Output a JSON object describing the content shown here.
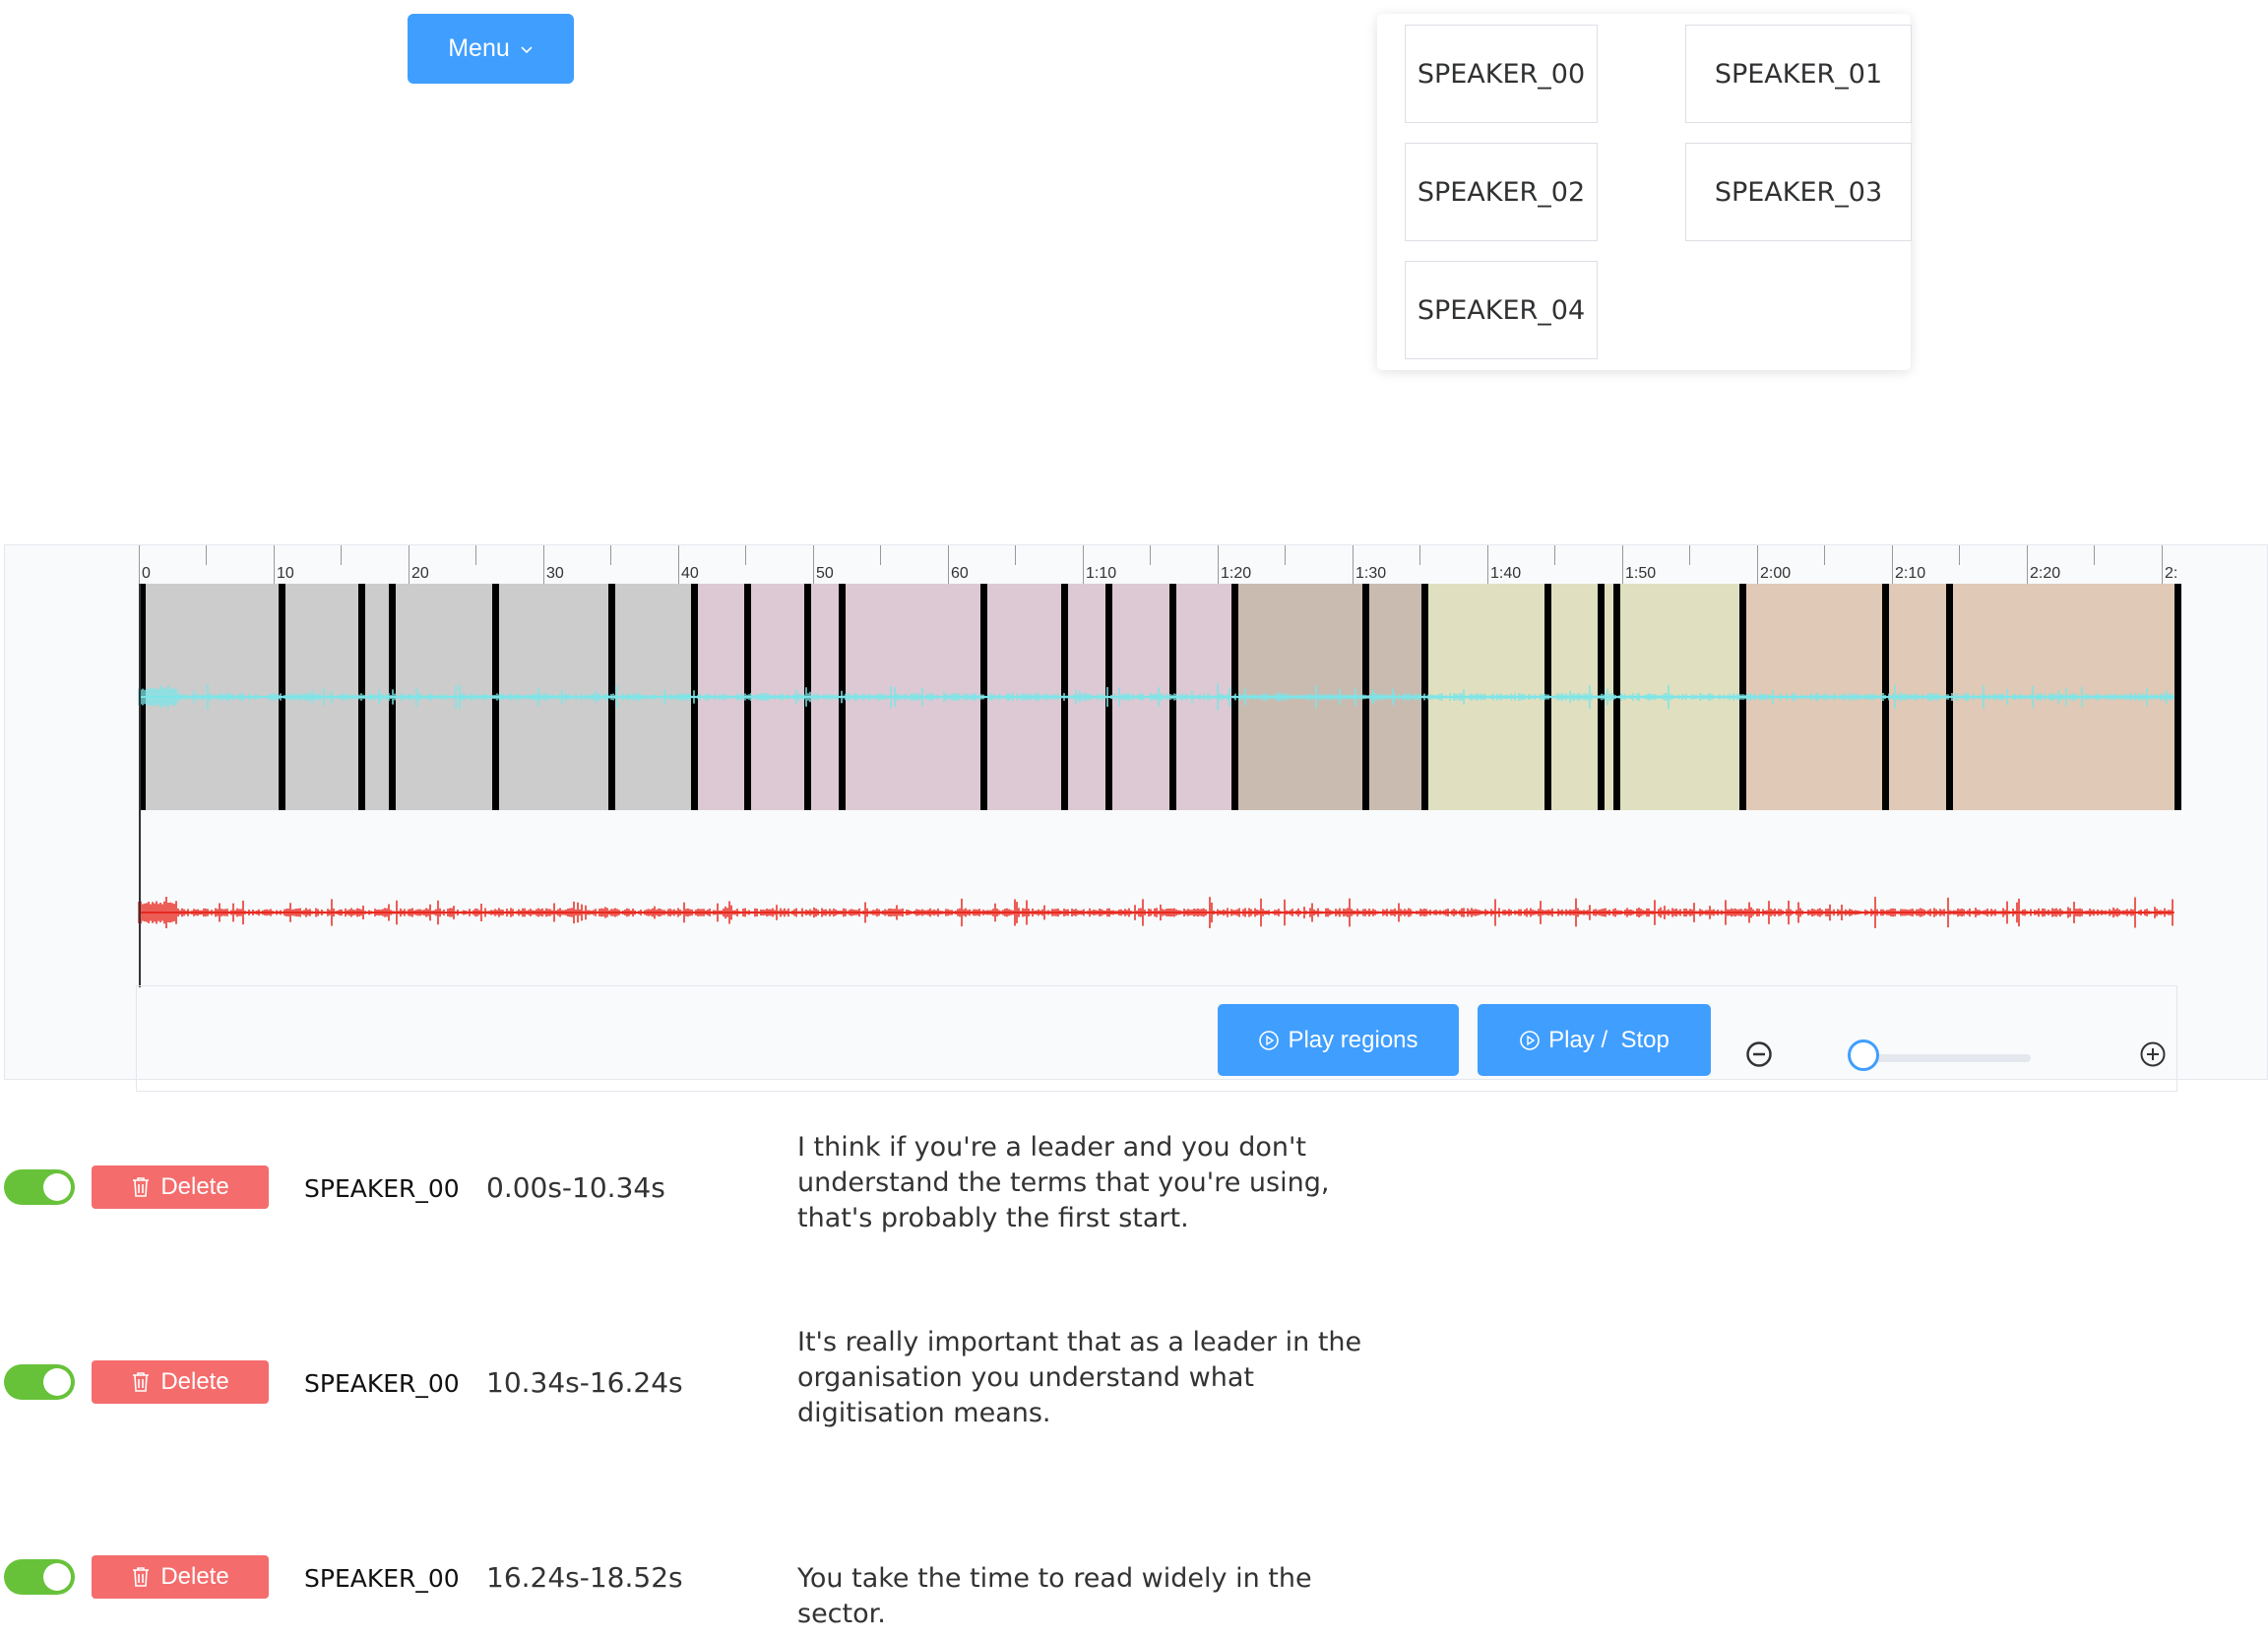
{
  "menu": {
    "label": "Menu"
  },
  "speakers": [
    "SPEAKER_00",
    "SPEAKER_01",
    "SPEAKER_02",
    "SPEAKER_03",
    "SPEAKER_04"
  ],
  "timeline": {
    "labels": [
      "0",
      "10",
      "20",
      "30",
      "40",
      "50",
      "60",
      "1:10",
      "1:20",
      "1:30",
      "1:40",
      "1:50",
      "2:00",
      "2:10",
      "2:20",
      "2:"
    ]
  },
  "regions": [
    {
      "speaker": "SPEAKER_00",
      "start": 0.0,
      "end": 10.34,
      "color": "#cccccc"
    },
    {
      "speaker": "SPEAKER_00",
      "start": 10.34,
      "end": 16.24,
      "color": "#cccccc"
    },
    {
      "speaker": "SPEAKER_00",
      "start": 16.24,
      "end": 18.52,
      "color": "#cccccc"
    },
    {
      "speaker": "SPEAKER_00",
      "start": 18.52,
      "end": 26.2,
      "color": "#cccccc"
    },
    {
      "speaker": "SPEAKER_00",
      "start": 26.2,
      "end": 34.8,
      "color": "#cccccc"
    },
    {
      "speaker": "SPEAKER_00",
      "start": 34.8,
      "end": 40.9,
      "color": "#cccccc"
    },
    {
      "speaker": "SPEAKER_01",
      "start": 40.9,
      "end": 44.8,
      "color": "#dcc9d3"
    },
    {
      "speaker": "SPEAKER_01",
      "start": 44.8,
      "end": 49.3,
      "color": "#dcc9d3"
    },
    {
      "speaker": "SPEAKER_01",
      "start": 49.3,
      "end": 51.8,
      "color": "#dcc9d3"
    },
    {
      "speaker": "SPEAKER_01",
      "start": 51.8,
      "end": 62.3,
      "color": "#dcc9d3"
    },
    {
      "speaker": "SPEAKER_01",
      "start": 62.3,
      "end": 68.3,
      "color": "#dcc9d3"
    },
    {
      "speaker": "SPEAKER_01",
      "start": 68.3,
      "end": 71.6,
      "color": "#dcc9d3"
    },
    {
      "speaker": "SPEAKER_01",
      "start": 71.6,
      "end": 76.3,
      "color": "#dcc9d3"
    },
    {
      "speaker": "SPEAKER_01",
      "start": 76.3,
      "end": 80.9,
      "color": "#dcc9d3"
    },
    {
      "speaker": "SPEAKER_02",
      "start": 80.9,
      "end": 90.6,
      "color": "#c9bbb0"
    },
    {
      "speaker": "SPEAKER_02",
      "start": 90.6,
      "end": 95.0,
      "color": "#c9bbb0"
    },
    {
      "speaker": "SPEAKER_03",
      "start": 95.0,
      "end": 104.1,
      "color": "#e0dfc0"
    },
    {
      "speaker": "SPEAKER_03",
      "start": 104.1,
      "end": 108.0,
      "color": "#e0dfc0"
    },
    {
      "speaker": "SPEAKER_03",
      "start": 108.0,
      "end": 109.2,
      "color": "#e0dfc0"
    },
    {
      "speaker": "SPEAKER_03",
      "start": 109.2,
      "end": 118.5,
      "color": "#e0dfc0"
    },
    {
      "speaker": "SPEAKER_04",
      "start": 118.5,
      "end": 129.1,
      "color": "#e0c9b6"
    },
    {
      "speaker": "SPEAKER_04",
      "start": 129.1,
      "end": 133.8,
      "color": "#e0c9b6"
    },
    {
      "speaker": "SPEAKER_04",
      "start": 133.8,
      "end": 151.0,
      "color": "#e0c9b6"
    }
  ],
  "controls": {
    "play_regions": "Play regions",
    "play_stop": "Play /  Stop"
  },
  "zoom": {
    "level": 0.0
  },
  "colors": {
    "primary": "#409eff",
    "danger": "#f56c6c",
    "success": "#67c23a",
    "waveform_top": "#7ce5e8",
    "waveform_bottom": "#e8291f"
  },
  "segments": [
    {
      "enabled": true,
      "delete": "Delete",
      "speaker": "SPEAKER_00",
      "time": "0.00s-10.34s",
      "text": "I think if you're a leader and you don't understand the terms that you're using, that's probably the first start."
    },
    {
      "enabled": true,
      "delete": "Delete",
      "speaker": "SPEAKER_00",
      "time": "10.34s-16.24s",
      "text": "It's really important that as a leader in the organisation you understand what digitisation means."
    },
    {
      "enabled": true,
      "delete": "Delete",
      "speaker": "SPEAKER_00",
      "time": "16.24s-18.52s",
      "text": "You take the time to read widely in the sector."
    }
  ]
}
